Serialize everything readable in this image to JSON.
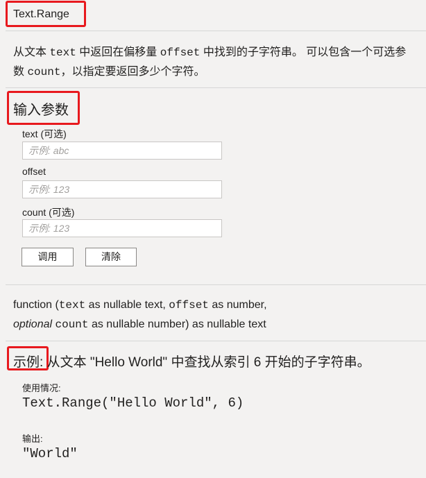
{
  "title": "Text.Range",
  "description": {
    "p1": "从文本 ",
    "code1": "text",
    "p2": " 中返回在偏移量 ",
    "code2": "offset",
    "p3": " 中找到的子字符串。 可以包含一个可选参数 ",
    "code3": "count",
    "p4": "，以指定要返回多少个字符。"
  },
  "params": {
    "heading": "输入参数",
    "fields": [
      {
        "label": "text (可选)",
        "placeholder": "示例: abc"
      },
      {
        "label": "offset",
        "placeholder": "示例: 123"
      },
      {
        "label": "count (可选)",
        "placeholder": "示例: 123"
      }
    ],
    "invoke_label": "调用",
    "clear_label": "清除"
  },
  "signature": {
    "prefix": "function (",
    "a1": "text",
    "t1": " as nullable text, ",
    "a2": "offset",
    "t2": " as number,",
    "optional": "optional",
    "a3": "count",
    "t3": " as nullable number) as nullable text"
  },
  "example": {
    "label": "示例:",
    "description": "从文本 \"Hello World\" 中查找从索引 6 开始的子字符串。",
    "usage_label": "使用情况:",
    "usage_code": "Text.Range(\"Hello World\", 6)",
    "output_label": "输出:",
    "output_code": "\"World\""
  }
}
